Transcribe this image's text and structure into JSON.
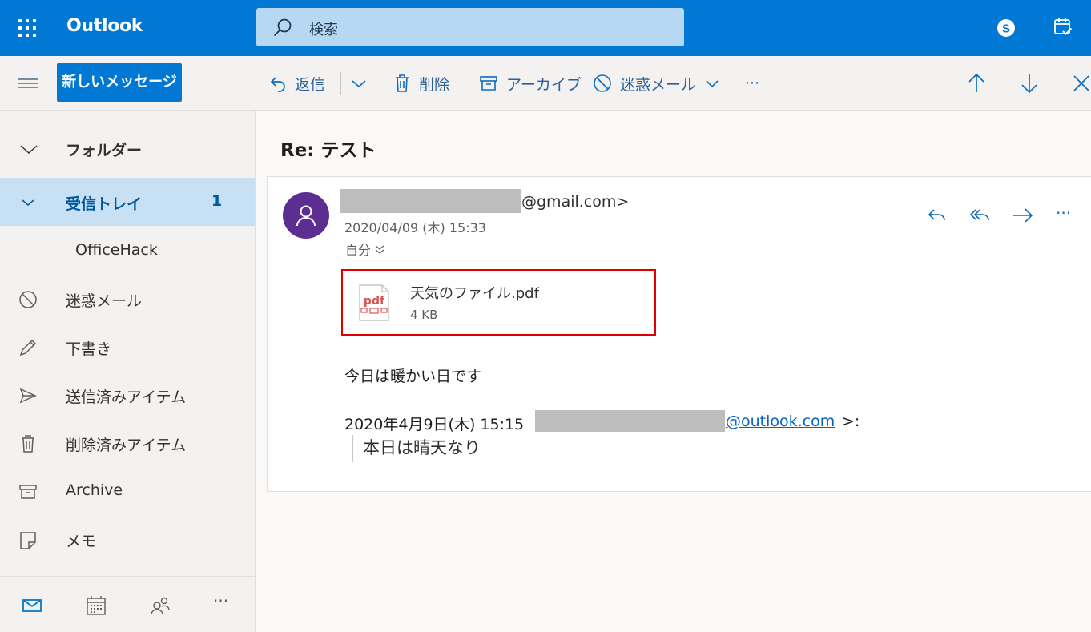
{
  "app": {
    "title": "Outlook"
  },
  "search": {
    "placeholder": "検索"
  },
  "toolbar": {
    "new_message": "新しいメッセージ",
    "reply": "返信",
    "delete": "削除",
    "archive": "アーカイブ",
    "junk": "迷惑メール",
    "more": "···"
  },
  "sidebar": {
    "folders_header": "フォルダー",
    "items": [
      {
        "label": "受信トレイ",
        "count": "1",
        "icon": "chevron-down-icon"
      },
      {
        "label": "OfficeHack",
        "icon": ""
      },
      {
        "label": "迷惑メール",
        "icon": "block-icon"
      },
      {
        "label": "下書き",
        "icon": "pencil-icon"
      },
      {
        "label": "送信済みアイテム",
        "icon": "send-icon"
      },
      {
        "label": "削除済みアイテム",
        "icon": "trash-icon"
      },
      {
        "label": "Archive",
        "icon": "archive-icon"
      },
      {
        "label": "メモ",
        "icon": "note-icon"
      }
    ],
    "bottom_more": "···"
  },
  "message": {
    "subject": "Re: テスト",
    "from_tail": "@gmail.com>",
    "date": "2020/04/09 (木) 15:33",
    "to": "自分",
    "more": "···",
    "attachment": {
      "name": "天気のファイル.pdf",
      "size": "4 KB",
      "icon_text": "pdf"
    },
    "body_line": "今日は暖かい日です",
    "quote_header_prefix": "2020年4月9日(木) 15:15",
    "quote_link": "@outlook.com",
    "quote_header_suffix": ">:",
    "quoted_text": "本日は晴天なり"
  },
  "colors": {
    "brand": "#0078d4",
    "selected_bg": "#c7e0f4",
    "avatar": "#5c2e91",
    "attachment_highlight": "#e00000",
    "link": "#0563c1"
  }
}
